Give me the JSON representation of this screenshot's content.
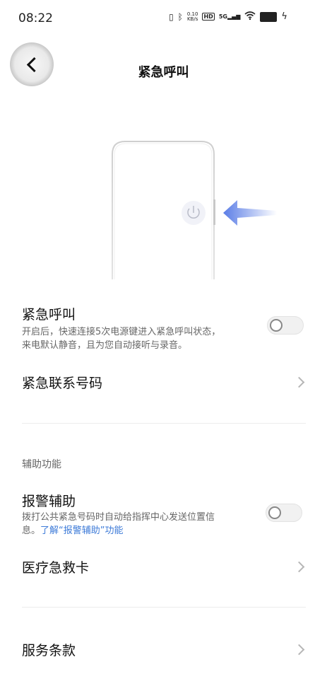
{
  "status_bar": {
    "time": "08:22",
    "network_speed_value": "0.10",
    "network_speed_unit": "KB/s",
    "hd_badge": "HD",
    "signal_label": "5G"
  },
  "header": {
    "title": "紧急呼叫"
  },
  "emergency_call": {
    "title": "紧急呼叫",
    "description_line1": "开启后，快速连接5次电源键进入紧急呼叫状态，",
    "description_line2": "来电默认静音，且为您自动接听与录音。",
    "enabled": false
  },
  "emergency_contacts": {
    "label": "紧急联系号码"
  },
  "assist_section": {
    "label": "辅助功能"
  },
  "alarm_assist": {
    "title": "报警辅助",
    "description_line1": "拨打公共紧急号码时自动给指挥中心发送位置信",
    "description_prefix": "息。",
    "description_link": "了解“报警辅助”功能",
    "enabled": false
  },
  "medical_card": {
    "label": "医疗急救卡"
  },
  "terms": {
    "label": "服务条款"
  },
  "colors": {
    "link": "#3e7bd8",
    "arrow": "#5a7de6",
    "toggle_off": "#f1f1f1"
  }
}
